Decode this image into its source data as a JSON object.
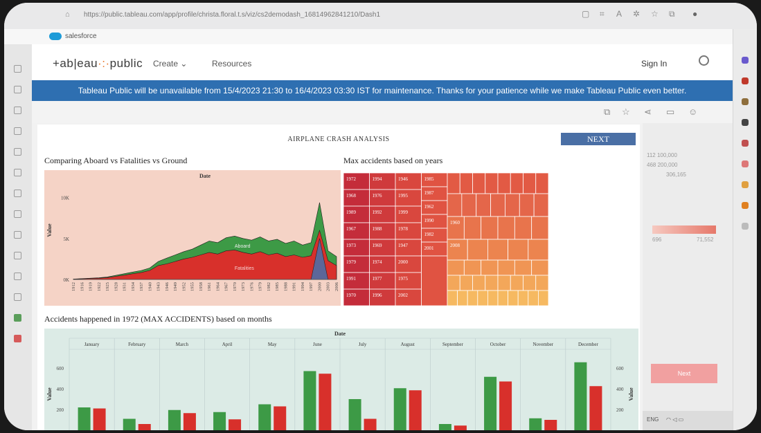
{
  "browser": {
    "url": "https://public.tableau.com/app/profile/christa.floral.t.s/viz/cs2demodash_16814962841210/Dash1",
    "bookmark_label": "salesforce"
  },
  "tableau_nav": {
    "logo_left": "+ab|eau",
    "logo_right": "public",
    "create": "Create ⌄",
    "resources": "Resources",
    "sign_in": "Sign In"
  },
  "banner": "Tableau Public will be unavailable from 15/4/2023 21:30 to 16/4/2023 03:30 IST for maintenance. Thanks for your patience while we make Tableau Public even better.",
  "side_panel": {
    "t1": "112  100,000",
    "t2": "468  200,000",
    "t3": "306,165",
    "t4": "696",
    "t5": "71,552",
    "next": "Next"
  },
  "taskbar": {
    "lang": "ENG"
  },
  "dashboard": {
    "title": "AIRPLANE CRASH ANALYSIS",
    "next_button": "NEXT",
    "area_title": "Comparing Aboard vs Fatalities vs Ground",
    "treemap_title": "Max accidents based on years",
    "bar_title": "Accidents happened in 1972 (MAX ACCIDENTS) based on months"
  },
  "colors": {
    "aboard": "#3d9a46",
    "fatalities": "#d8302b",
    "ground": "#4f6da6",
    "area_bg": "#f5d3c6",
    "bar_bg": "#dcebe6"
  },
  "chart_data": [
    {
      "type": "area",
      "title": "Comparing Aboard vs Fatalities vs Ground",
      "header": "Date",
      "ylabel": "Value",
      "yticks": [
        "10K",
        "5K",
        "0K"
      ],
      "ylim": [
        0,
        12000
      ],
      "x_labels": [
        "1912",
        "1916",
        "1919",
        "1922",
        "1925",
        "1928",
        "1931",
        "1934",
        "1937",
        "1940",
        "1943",
        "1946",
        "1949",
        "1952",
        "1955",
        "1958",
        "1961",
        "1964",
        "1967",
        "1970",
        "1973",
        "1976",
        "1979",
        "1982",
        "1985",
        "1988",
        "1991",
        "1994",
        "1997",
        "2000",
        "2003",
        "2006"
      ],
      "series": [
        {
          "name": "Aboard",
          "values": [
            50,
            100,
            150,
            200,
            300,
            500,
            700,
            900,
            1100,
            1400,
            2200,
            2600,
            3000,
            3400,
            3700,
            4200,
            4700,
            4500,
            5100,
            5300,
            5000,
            4800,
            5200,
            4700,
            4900,
            4400,
            4700,
            4200,
            4500,
            9400,
            3500,
            2800
          ]
        },
        {
          "name": "Fatalities",
          "values": [
            40,
            80,
            120,
            150,
            230,
            380,
            520,
            700,
            850,
            1100,
            1700,
            1900,
            2200,
            2500,
            2700,
            3000,
            3300,
            3100,
            3500,
            3600,
            3300,
            3100,
            3400,
            3000,
            3200,
            2800,
            3000,
            2700,
            2900,
            6000,
            2300,
            1700
          ]
        },
        {
          "name": "Ground",
          "values": [
            0,
            0,
            0,
            0,
            0,
            0,
            0,
            0,
            0,
            0,
            0,
            0,
            0,
            0,
            0,
            0,
            0,
            0,
            0,
            0,
            0,
            0,
            0,
            0,
            0,
            0,
            0,
            0,
            0,
            5000,
            0,
            0
          ]
        }
      ]
    },
    {
      "type": "heatmap",
      "title": "Max accidents based on years",
      "columns": [
        [
          "1972",
          "1968",
          "1989",
          "1967",
          "1973",
          "1979",
          "1991",
          "1970"
        ],
        [
          "1994",
          "1976",
          "1992",
          "1988",
          "1969",
          "1974",
          "1977",
          "1996"
        ],
        [
          "1946",
          "1995",
          "1999",
          "1978",
          "1947",
          "2000",
          "1975",
          "2002"
        ],
        [
          "1985",
          "1987",
          "1962",
          "1990",
          "1982",
          "2001"
        ]
      ],
      "extra_labels": [
        "1960",
        "2008"
      ]
    },
    {
      "type": "bar",
      "title": "Accidents happened in 1972 (MAX ACCIDENTS) based on months",
      "header": "Date",
      "ylabel": "Value",
      "yticks": [
        "600",
        "400",
        "200"
      ],
      "ylim": [
        0,
        700
      ],
      "categories": [
        "January",
        "February",
        "March",
        "April",
        "May",
        "June",
        "July",
        "August",
        "September",
        "October",
        "November",
        "December"
      ],
      "series": [
        {
          "name": "Aboard",
          "values": [
            220,
            110,
            195,
            175,
            250,
            570,
            300,
            405,
            60,
            515,
            115,
            655
          ]
        },
        {
          "name": "Fatalities",
          "values": [
            210,
            60,
            165,
            105,
            230,
            545,
            110,
            385,
            45,
            470,
            100,
            425
          ]
        }
      ]
    }
  ]
}
